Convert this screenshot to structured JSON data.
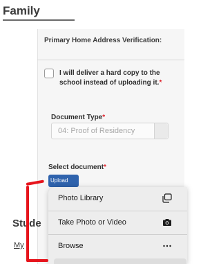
{
  "section": {
    "title": "Family"
  },
  "card": {
    "heading": "Primary Home Address Verification:"
  },
  "checkbox": {
    "label": "I will deliver a hard copy to the school instead of uploading it.",
    "required_mark": "*",
    "checked": false
  },
  "document_type": {
    "label": "Document Type",
    "required_mark": "*",
    "value": "04: Proof of Residency"
  },
  "select_document": {
    "label": "Select document",
    "required_mark": "*",
    "button_label": "Upload"
  },
  "background": {
    "section_title": "Stude",
    "link_text": "My"
  },
  "action_menu": {
    "items": [
      {
        "label": "Photo Library",
        "icon": "photo-library-icon"
      },
      {
        "label": "Take Photo or Video",
        "icon": "camera-icon"
      },
      {
        "label": "Browse",
        "icon": "more-icon"
      }
    ]
  },
  "annotation": {
    "color": "#e6141c"
  },
  "colors": {
    "required": "#e0262f",
    "upload_button": "#2f63ad"
  }
}
